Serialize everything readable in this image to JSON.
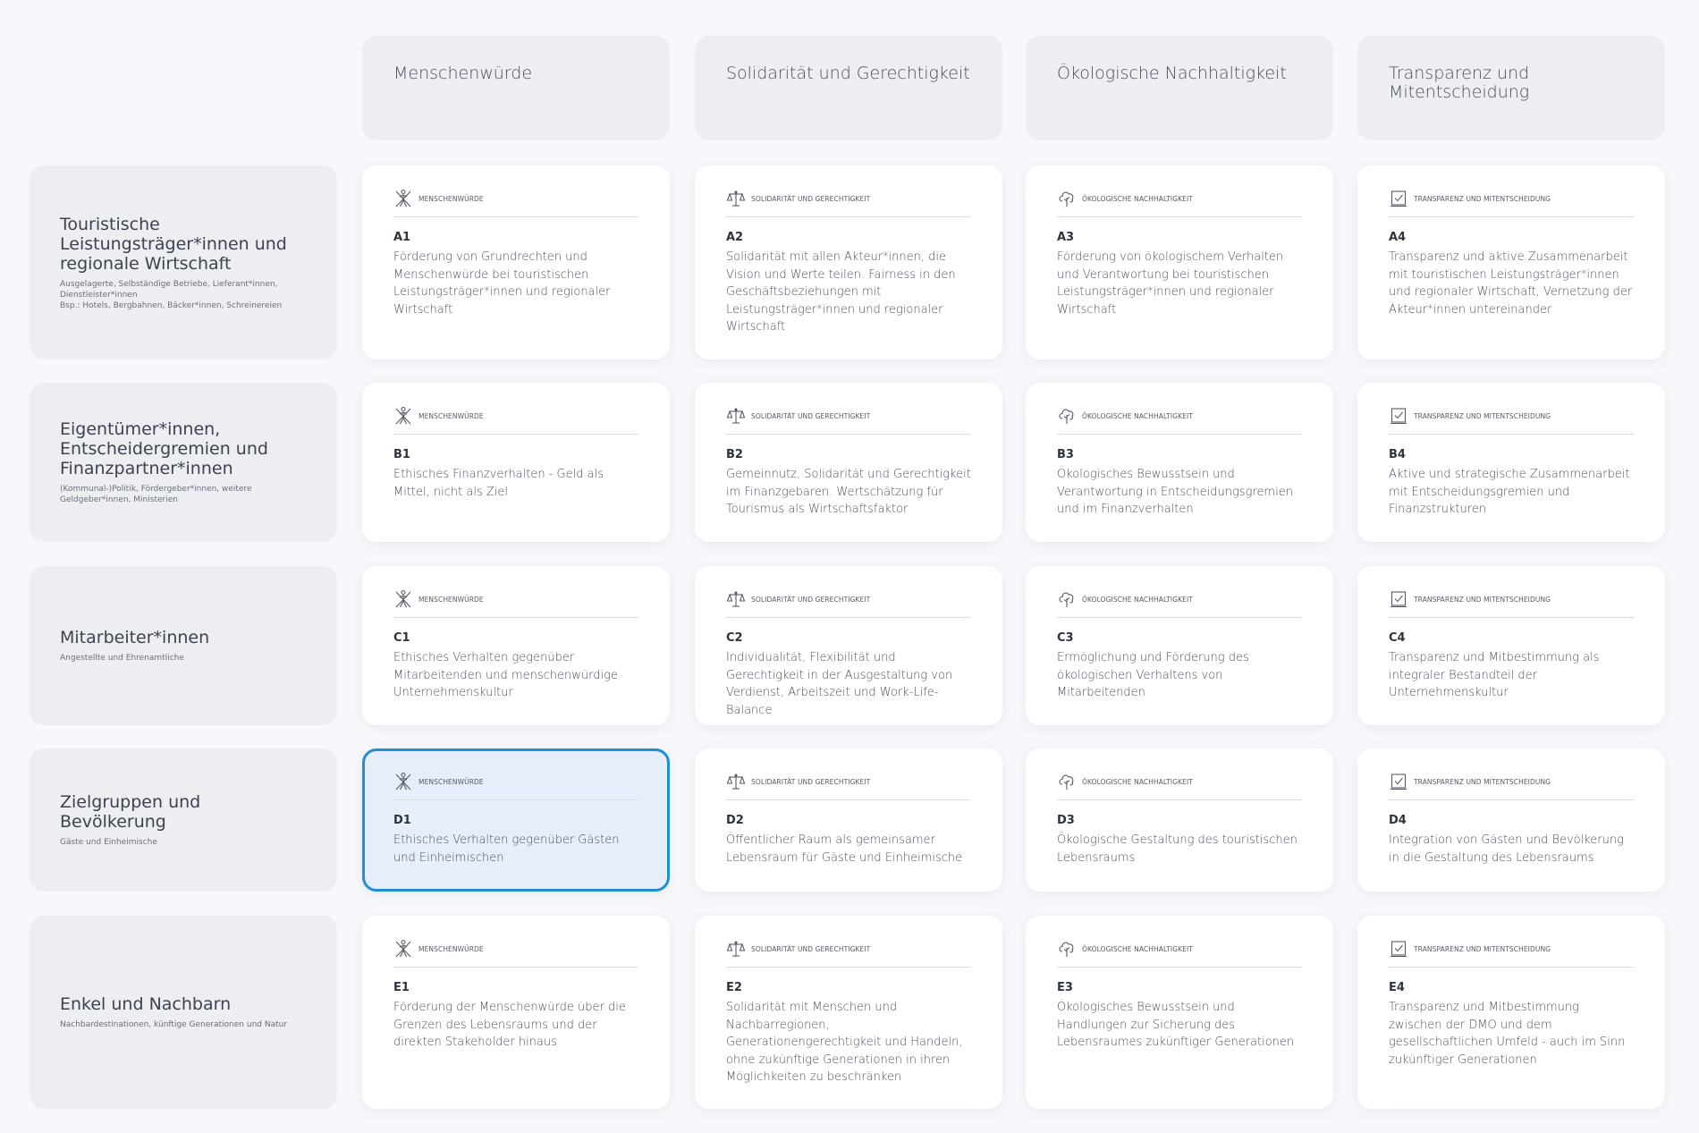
{
  "columns": [
    {
      "label": "Menschenwürde",
      "category": "Menschenwürde",
      "icon": "person-icon"
    },
    {
      "label": "Solidarität und Gerechtigkeit",
      "category": "Solidarität und Gerechtigkeit",
      "icon": "scales-icon"
    },
    {
      "label": "Ökologische Nachhaltigkeit",
      "category": "Ökologische Nachhaltigkeit",
      "icon": "tree-icon"
    },
    {
      "label": "Transparenz und Mitentscheidung",
      "category": "Transparenz und Mitentscheidung",
      "icon": "ballot-icon"
    }
  ],
  "rows": [
    {
      "title": "Touristische Leistungsträger*innen und regionale Wirtschaft",
      "subtitle": "Ausgelagerte, Selbständige Betriebe, Lieferant*innen, Dienstleister*innen\nBsp.: Hotels, Bergbahnen, Bäcker*innen, Schreinereien",
      "cells": [
        {
          "code": "A1",
          "text": "Förderung von Grundrechten und Menschenwürde bei touristischen Leistungsträger*innen und regionaler Wirtschaft"
        },
        {
          "code": "A2",
          "text": "Solidarität mit allen Akteur*innen, die Vision und Werte teilen. Fairness in den Geschäftsbeziehungen mit Leistungsträger*innen und regionaler Wirtschaft"
        },
        {
          "code": "A3",
          "text": "Förderung von ökologischem Verhalten und Verantwortung bei touristischen Leistungsträger*innen und regionaler Wirtschaft"
        },
        {
          "code": "A4",
          "text": "Transparenz und aktive Zusammenarbeit mit touristischen Leistungsträger*innen und regionaler Wirtschaft, Vernetzung der Akteur*innen untereinander"
        }
      ]
    },
    {
      "title": "Eigentümer*innen, Entscheidergremien und Finanzpartner*innen",
      "subtitle": "(Kommunal-)Politik, Fördergeber*innen, weitere Geldgeber*innen, Ministerien",
      "cells": [
        {
          "code": "B1",
          "text": "Ethisches Finanzverhalten - Geld als Mittel, nicht als Ziel"
        },
        {
          "code": "B2",
          "text": "Gemeinnutz, Solidarität und Gerechtigkeit im Finanzgebaren. Wertschätzung für Tourismus als Wirtschaftsfaktor"
        },
        {
          "code": "B3",
          "text": "Ökologisches Bewusstsein und Verantwortung in Entscheidungsgremien und im Finanzverhalten"
        },
        {
          "code": "B4",
          "text": "Aktive und strategische Zusammenarbeit mit Entscheidungsgremien und Finanzstrukturen"
        }
      ]
    },
    {
      "title": "Mitarbeiter*innen",
      "subtitle": "Angestellte und Ehrenamtliche",
      "cells": [
        {
          "code": "C1",
          "text": "Ethisches Verhalten gegenüber Mitarbeitenden und menschenwürdige Unternehmenskultur"
        },
        {
          "code": "C2",
          "text": "Individualität, Flexibilität und Gerechtigkeit in der Ausgestaltung von Verdienst, Arbeitszeit und Work-Life-Balance"
        },
        {
          "code": "C3",
          "text": "Ermöglichung und Förderung des ökologischen Verhaltens von Mitarbeitenden"
        },
        {
          "code": "C4",
          "text": "Transparenz und Mitbestimmung als integraler Bestandteil der Unternehmenskultur"
        }
      ]
    },
    {
      "title": "Zielgruppen und Bevölkerung",
      "subtitle": "Gäste und Einheimische",
      "cells": [
        {
          "code": "D1",
          "text": "Ethisches Verhalten gegenüber Gästen und Einheimischen",
          "selected": true
        },
        {
          "code": "D2",
          "text": "Öffentlicher Raum als gemeinsamer Lebensraum für Gäste und Einheimische"
        },
        {
          "code": "D3",
          "text": "Ökologische Gestaltung des touristischen Lebensraums"
        },
        {
          "code": "D4",
          "text": "Integration von Gästen und Bevölkerung in die Gestaltung des Lebensraums"
        }
      ]
    },
    {
      "title": "Enkel und Nachbarn",
      "subtitle": "Nachbardestinationen, künftige Generationen und Natur",
      "cells": [
        {
          "code": "E1",
          "text": "Förderung der Menschenwürde über die Grenzen des Lebensraums und der direkten Stakeholder hinaus"
        },
        {
          "code": "E2",
          "text": "Solidarität mit Menschen und Nachbarregionen, Generationengerechtigkeit und Handeln, ohne zukünftige Generationen in ihren Möglichkeiten zu beschränken"
        },
        {
          "code": "E3",
          "text": "Ökologisches Bewusstsein und Handlungen zur Sicherung des Lebensraumes zukünftiger Generationen"
        },
        {
          "code": "E4",
          "text": "Transparenz und Mitbestimmung zwischen der DMO und dem gesellschaftlichen Umfeld - auch im Sinn zukünftiger Generationen"
        }
      ]
    }
  ],
  "colors": {
    "background": "#f7f8fb",
    "header_bg": "#eceef2",
    "card_bg": "#ffffff",
    "selected_bg": "#e6edfb",
    "selected_border": "#1f8ed4"
  }
}
